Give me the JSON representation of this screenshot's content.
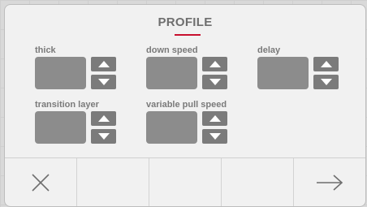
{
  "dialog": {
    "title": "PROFILE",
    "accent_color": "#c8102e"
  },
  "fields": [
    {
      "label": "thick"
    },
    {
      "label": "down speed"
    },
    {
      "label": "delay"
    },
    {
      "label": "transition layer"
    },
    {
      "label": "variable pull speed"
    }
  ],
  "footer": {
    "cancel_icon": "close-icon",
    "next_icon": "arrow-right-icon"
  }
}
